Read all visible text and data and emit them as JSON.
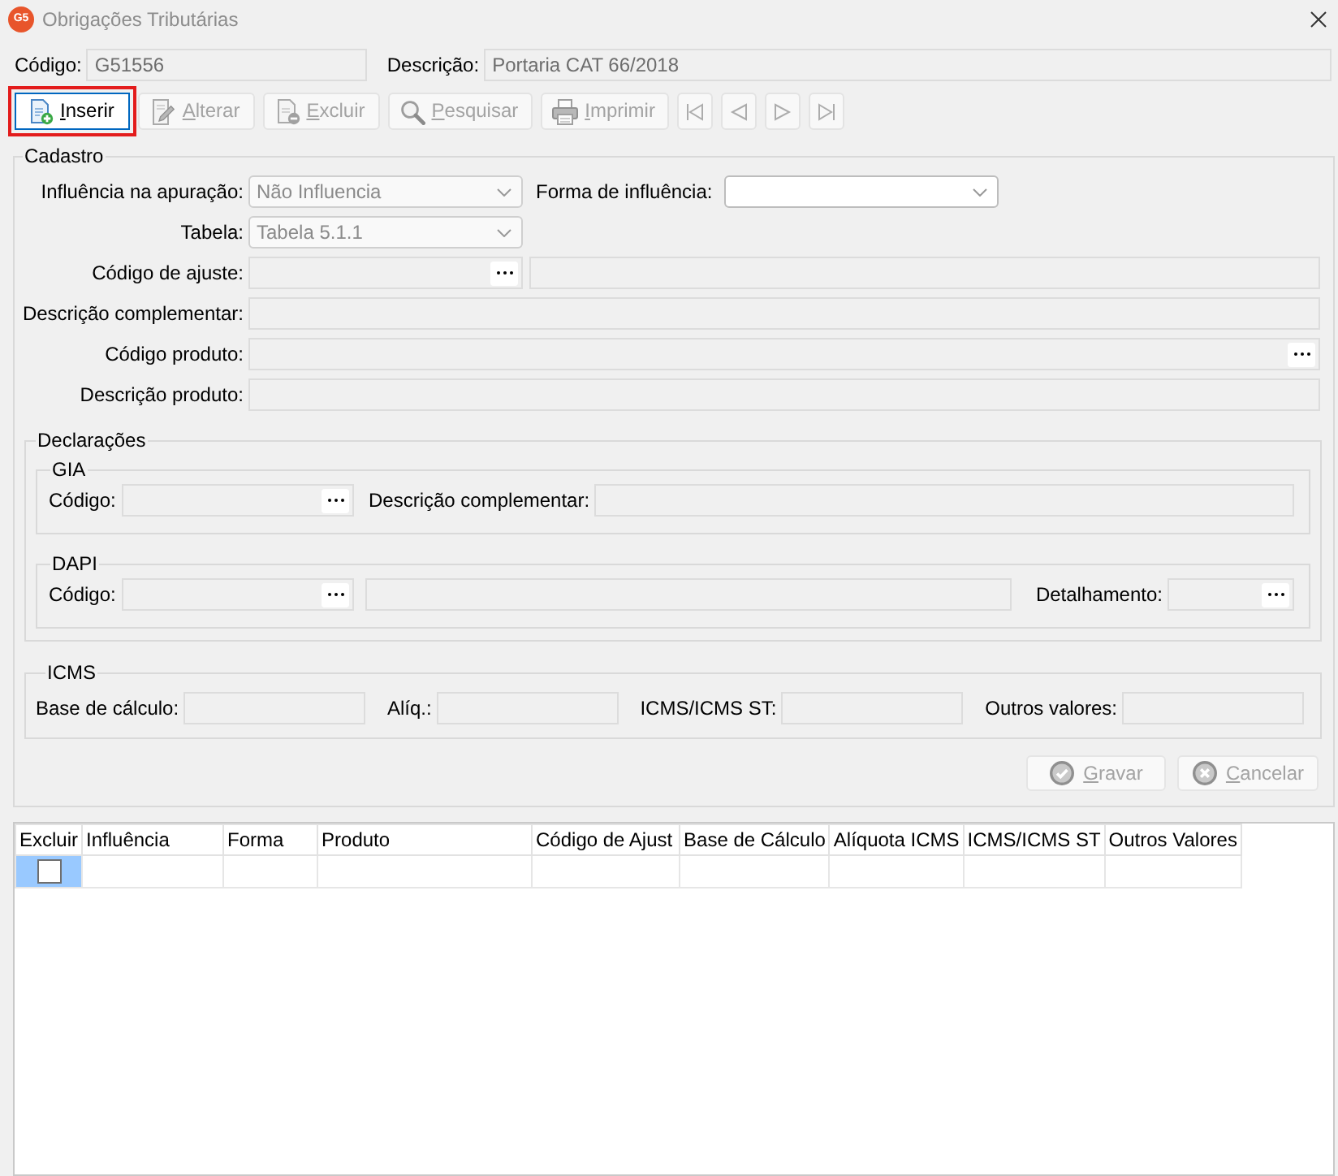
{
  "window": {
    "logo_text": "G5",
    "title": "Obrigações Tributárias"
  },
  "header": [
    {
      "label": "Código:",
      "value": "G51556"
    },
    {
      "label": "Descrição:",
      "value": "Portaria CAT 66/2018"
    }
  ],
  "toolbar": [
    {
      "kind": "insert",
      "label": "Inserir",
      "disabled": false,
      "highlighted": true
    },
    {
      "kind": "edit",
      "label": "Alterar",
      "disabled": true,
      "highlighted": false
    },
    {
      "kind": "delete",
      "label": "Excluir",
      "disabled": true,
      "highlighted": false
    },
    {
      "kind": "search",
      "label": "Pesquisar",
      "disabled": true,
      "highlighted": false
    },
    {
      "kind": "print",
      "label": "Imprimir",
      "disabled": true,
      "highlighted": false
    },
    {
      "kind": "first",
      "disabled": true,
      "highlighted": false
    },
    {
      "kind": "prior",
      "disabled": true,
      "highlighted": false
    },
    {
      "kind": "next",
      "disabled": true,
      "highlighted": false
    },
    {
      "kind": "last",
      "disabled": true,
      "highlighted": false
    }
  ],
  "cadastro": {
    "title": "Cadastro",
    "influencia": {
      "label": "Influência na apuração:",
      "value": "Não Influencia",
      "disabled": true
    },
    "forma": {
      "label": "Forma de influência:",
      "disabled": false
    },
    "tabela": {
      "label": "Tabela:",
      "value": "Tabela 5.1.1",
      "disabled": true
    },
    "codigo_ajuste": {
      "label": "Código de ajuste:"
    },
    "descricao_complementar": {
      "label": "Descrição complementar:"
    },
    "codigo_produto": {
      "label": "Código produto:"
    },
    "descricao_produto": {
      "label": "Descrição produto:"
    },
    "declaracoes": {
      "title": "Declarações",
      "gia": {
        "title": "GIA",
        "codigo_label": "Código:",
        "descricao_label": "Descrição complementar:"
      },
      "dapi": {
        "title": "DAPI",
        "codigo_label": "Código:",
        "detalhamento_label": "Detalhamento:"
      }
    },
    "icms": {
      "title": "ICMS",
      "fields": [
        {
          "label": "Base de cálculo:"
        },
        {
          "label": "Alíq.:"
        },
        {
          "label": "ICMS/ICMS ST:"
        },
        {
          "label": "Outros valores:"
        }
      ]
    },
    "actions": [
      {
        "kind": "save",
        "label": "Gravar",
        "disabled": true
      },
      {
        "kind": "cancel",
        "label": "Cancelar",
        "disabled": true
      }
    ]
  },
  "grid": {
    "columns": [
      "Excluir",
      "Influência",
      "Forma",
      "Produto",
      "Código de Ajust",
      "Base de Cálculo",
      "Alíquota ICMS",
      "ICMS/ICMS ST",
      "Outros Valores"
    ],
    "rows": [
      {
        "selected": true,
        "checked": false
      }
    ]
  }
}
